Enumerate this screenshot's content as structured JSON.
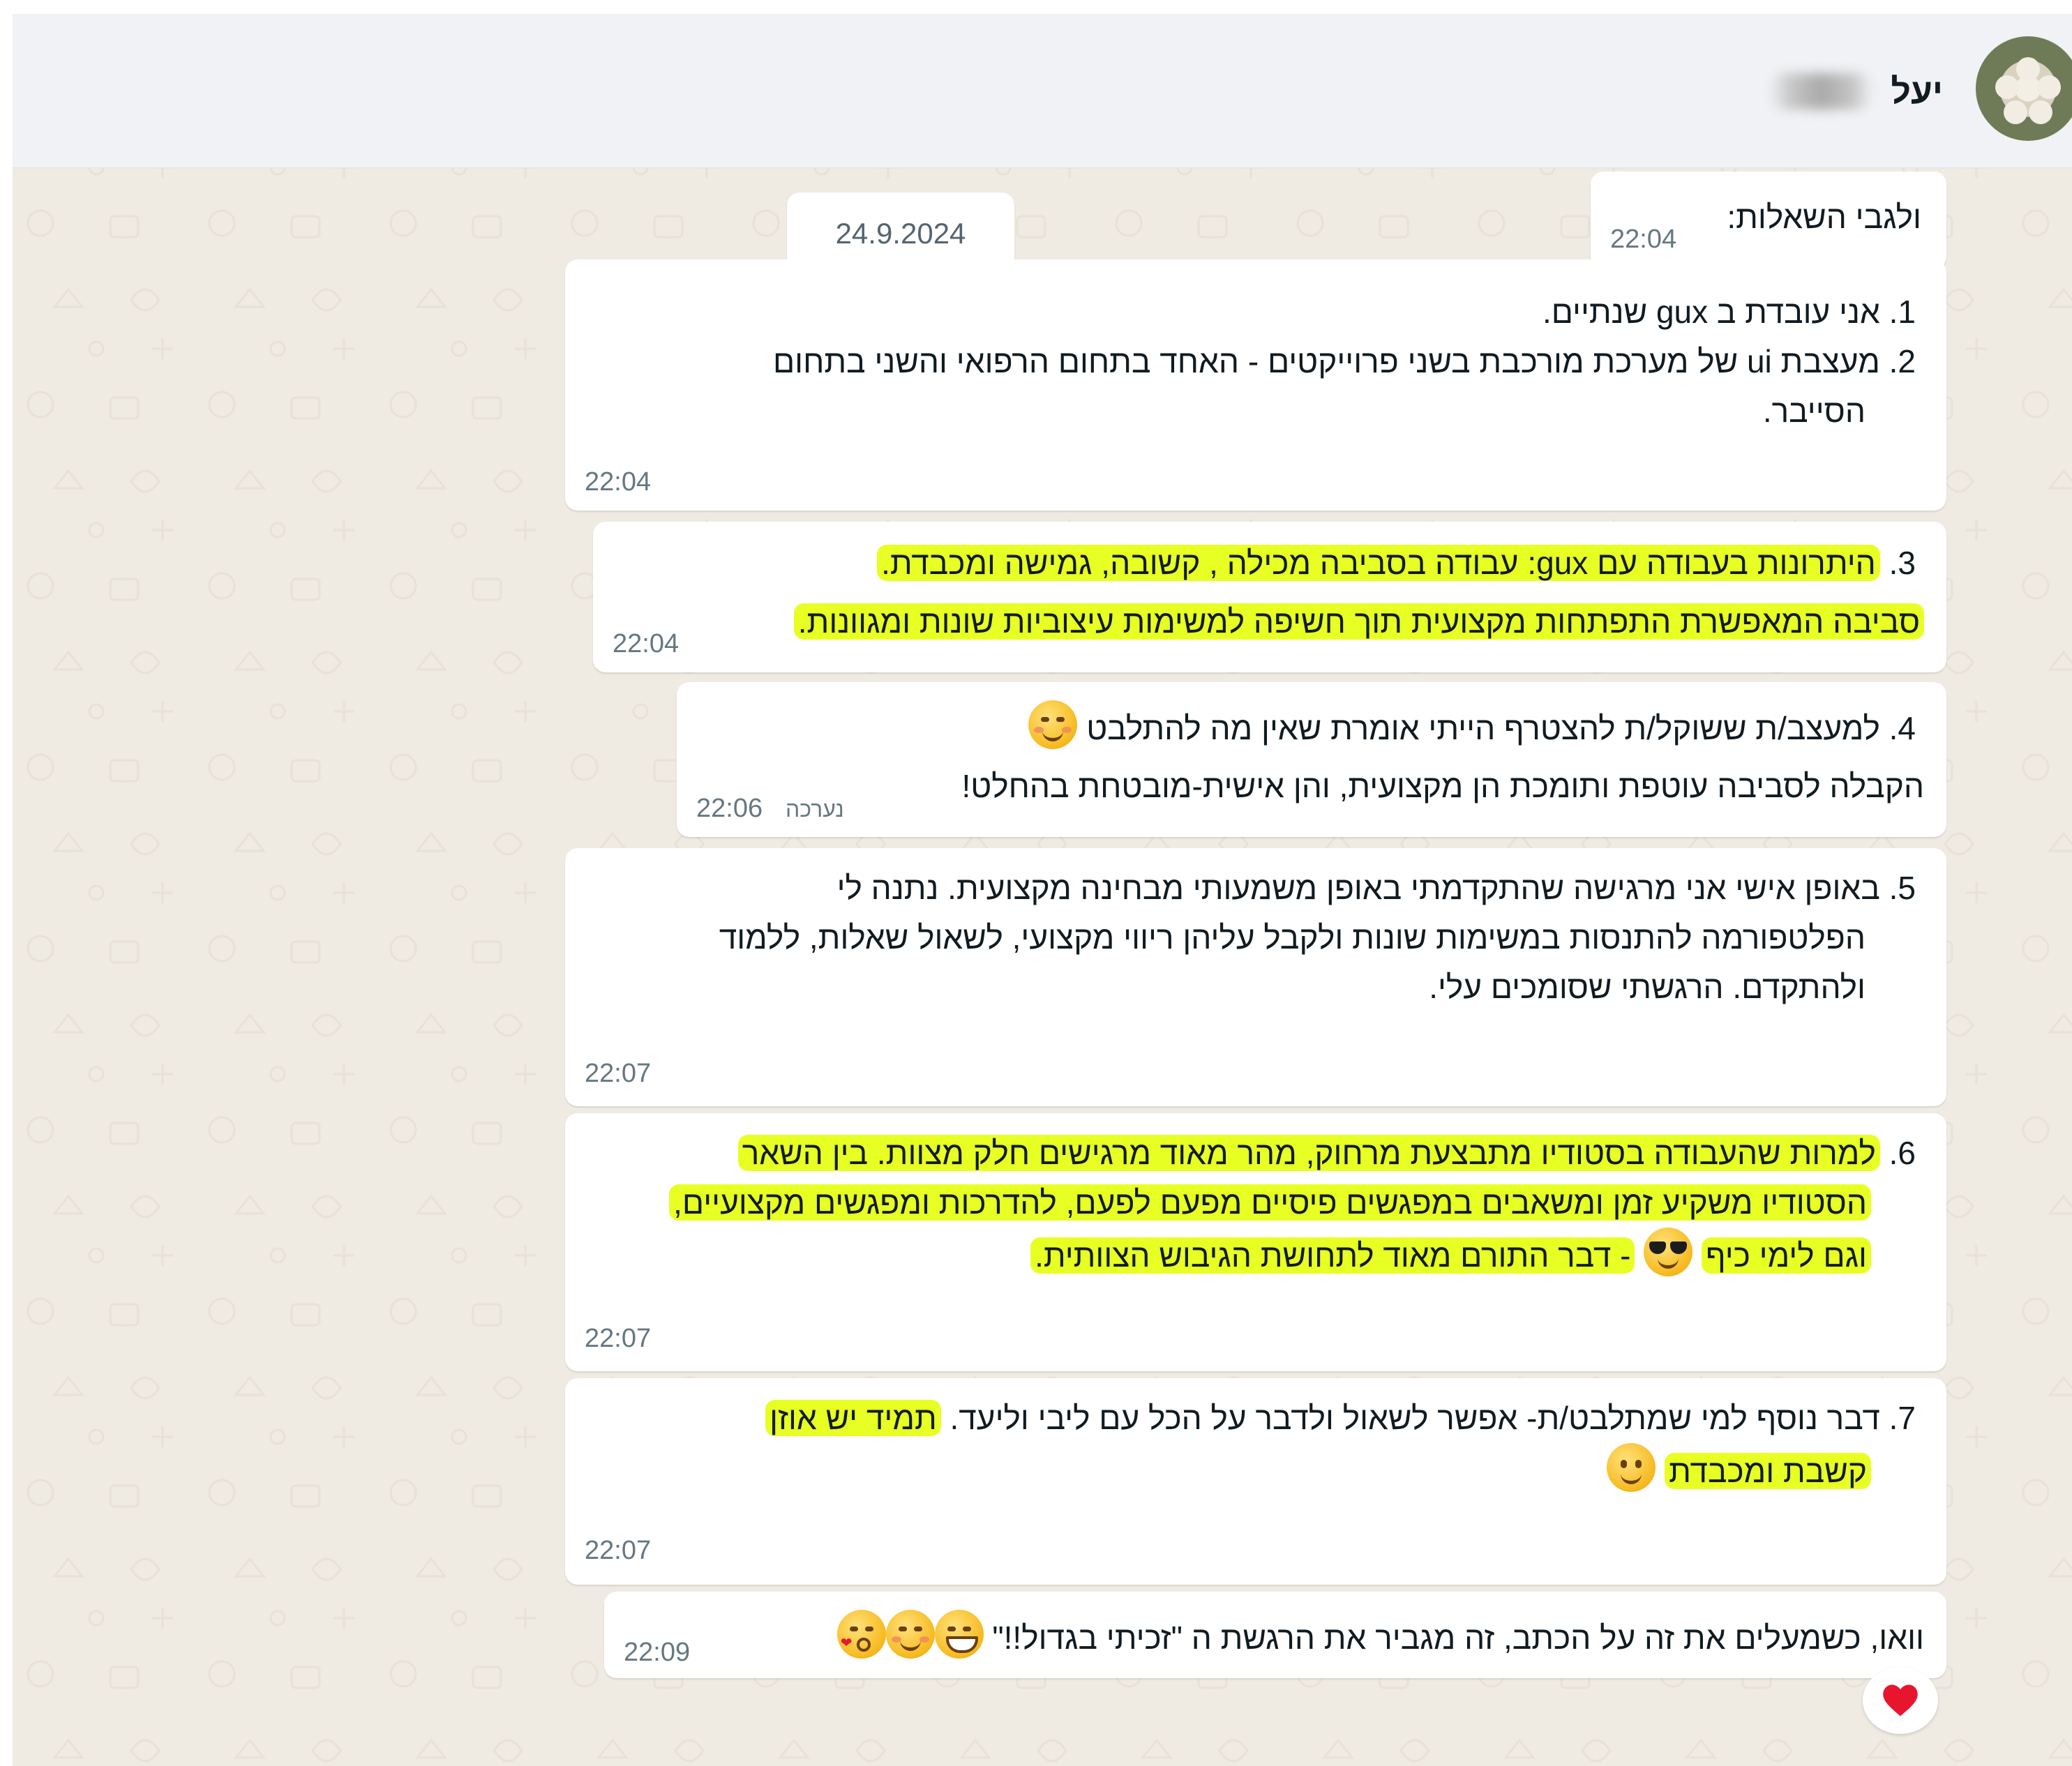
{
  "header": {
    "contact_name": "יעל"
  },
  "date_chip": "24.9.2024",
  "messages": [
    {
      "time": "22:04",
      "text": "ולגבי השאלות:"
    },
    {
      "time": "22:04",
      "items": [
        {
          "num": "1.",
          "lines": [
            "אני עובדת ב gux שנתיים."
          ]
        },
        {
          "num": "2.",
          "lines": [
            "מעצבת ui של מערכת מורכבת בשני פרוייקטים - האחד בתחום הרפואי והשני בתחום",
            "הסייבר."
          ]
        }
      ]
    },
    {
      "time": "22:04",
      "num": "3.",
      "line1": "היתרונות בעבודה עם gux: עבודה בסביבה מכילה , קשובה, גמישה ומכבדת.",
      "line2": "סביבה המאפשרת התפתחות מקצועית תוך חשיפה למשימות עיצוביות שונות ומגוונות."
    },
    {
      "time": "22:06",
      "edited": "נערכה",
      "num": "4.",
      "line1": "למעצב/ת ששוקל/ת להצטרף הייתי אומרת שאין מה להתלבט",
      "line2": "הקבלה לסביבה עוטפת ותומכת הן מקצועית, והן אישית-מובטחת בהחלט!"
    },
    {
      "time": "22:07",
      "num": "5.",
      "lines": [
        "באופן אישי אני מרגישה שהתקדמתי באופן משמעותי מבחינה מקצועית. נתנה לי",
        "הפלטפורמה להתנסות במשימות שונות ולקבל עליהן ריווי מקצועי, לשאול שאלות, ללמוד",
        "ולהתקדם. הרגשתי שסומכים עלי."
      ]
    },
    {
      "time": "22:07",
      "num": "6.",
      "line1": "למרות שהעבודה בסטודיו מתבצעת מרחוק, מהר מאוד מרגישים חלק מצוות. בין השאר",
      "line2": "הסטודיו משקיע זמן ומשאבים במפגשים פיסיים מפעם לפעם, להדרכות ומפגשים מקצועיים,",
      "line3_a": "וגם לימי כיף",
      "line3_b": "- דבר התורם מאוד לתחושת הגיבוש הצוותית."
    },
    {
      "time": "22:07",
      "num": "7.",
      "line1_plain": "דבר נוסף למי שמתלבט/ת- אפשר לשאול ולדבר על הכל עם ליבי וליעד.",
      "line1_hl": "תמיד יש אוזן",
      "line2_hl": "קשבת ומכבדת"
    },
    {
      "time": "22:09",
      "text": "וואו, כשמעלים את זה על הכתב, זה מגביר את הרגשת ה \"זכיתי בגדול!!\""
    }
  ],
  "reaction": {
    "icon": "heart-icon",
    "color": "#e8152f"
  },
  "colors": {
    "highlight": "#e8ff24",
    "chat_bg": "#efeae2",
    "header_bg": "#f0f2f5"
  }
}
